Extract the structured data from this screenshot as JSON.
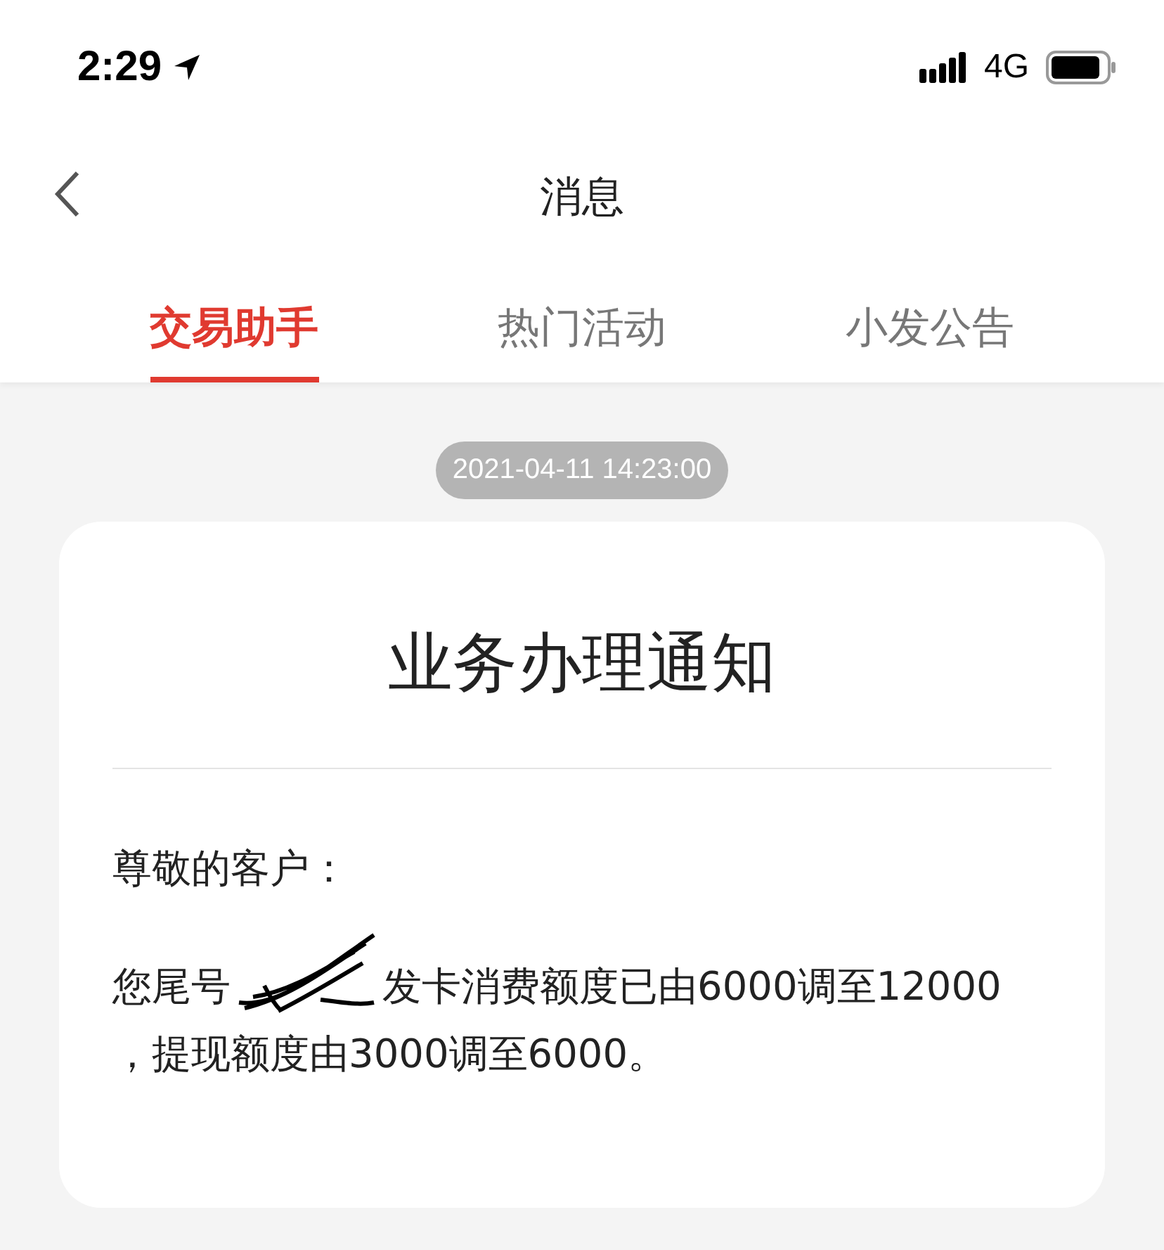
{
  "status_bar": {
    "time": "2:29",
    "network": "4G"
  },
  "nav": {
    "title": "消息"
  },
  "tabs": [
    {
      "label": "交易助手",
      "selected": true
    },
    {
      "label": "热门活动",
      "selected": false
    },
    {
      "label": "小发公告",
      "selected": false
    }
  ],
  "messages": [
    {
      "timestamp": "2021-04-11 14:23:00",
      "title": "业务办理通知",
      "greeting": "尊敬的客户：",
      "text_before": "您尾号",
      "text_after": "发卡消费额度已由6000调至12000",
      "text_continued": "，提现额度由3000调至6000。"
    }
  ]
}
